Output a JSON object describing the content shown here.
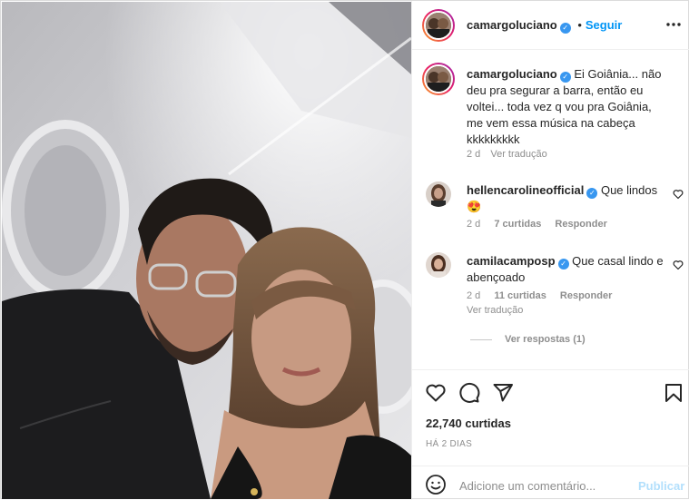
{
  "post": {
    "author": "camargoluciano",
    "follow_label": "Seguir",
    "more_icon": "more-horizontal-icon",
    "caption": "Ei Goiânia... não deu pra segurar a barra, então eu voltei... toda vez q vou pra Goiânia, me vem essa música na cabeça kkkkkkkkk",
    "caption_lines": [
      "Ei Goiânia... não",
      "deu pra segurar a barra, então eu",
      "voltei... toda vez q vou pra Goiânia,",
      "me vem essa música na cabeça",
      "kkkkkkkkk"
    ],
    "caption_time": "2 d",
    "translate_label": "Ver tradução"
  },
  "comments": [
    {
      "user": "hellencarolineofficial",
      "text": "Que lindos",
      "emoji": "😍",
      "time": "2 d",
      "likes": "7 curtidas",
      "reply": "Responder"
    },
    {
      "user": "camilacamposp",
      "text_line1": "Que casal lindo e",
      "text_line2": "abençoado",
      "time": "2 d",
      "likes": "11 curtidas",
      "reply": "Responder",
      "translate": "Ver tradução",
      "view_replies": "Ver respostas (1)"
    }
  ],
  "actions": {
    "icons": [
      "heart-icon",
      "comment-icon",
      "share-icon",
      "bookmark-icon"
    ],
    "likes": "22,740 curtidas",
    "date": "HÁ 2 DIAS"
  },
  "add_comment": {
    "placeholder": "Adicione um comentário...",
    "publish": "Publicar",
    "emoji_icon": "emoji-icon"
  },
  "colors": {
    "link": "#0095f6",
    "verified": "#3897f0",
    "muted": "#8e8e8e"
  }
}
